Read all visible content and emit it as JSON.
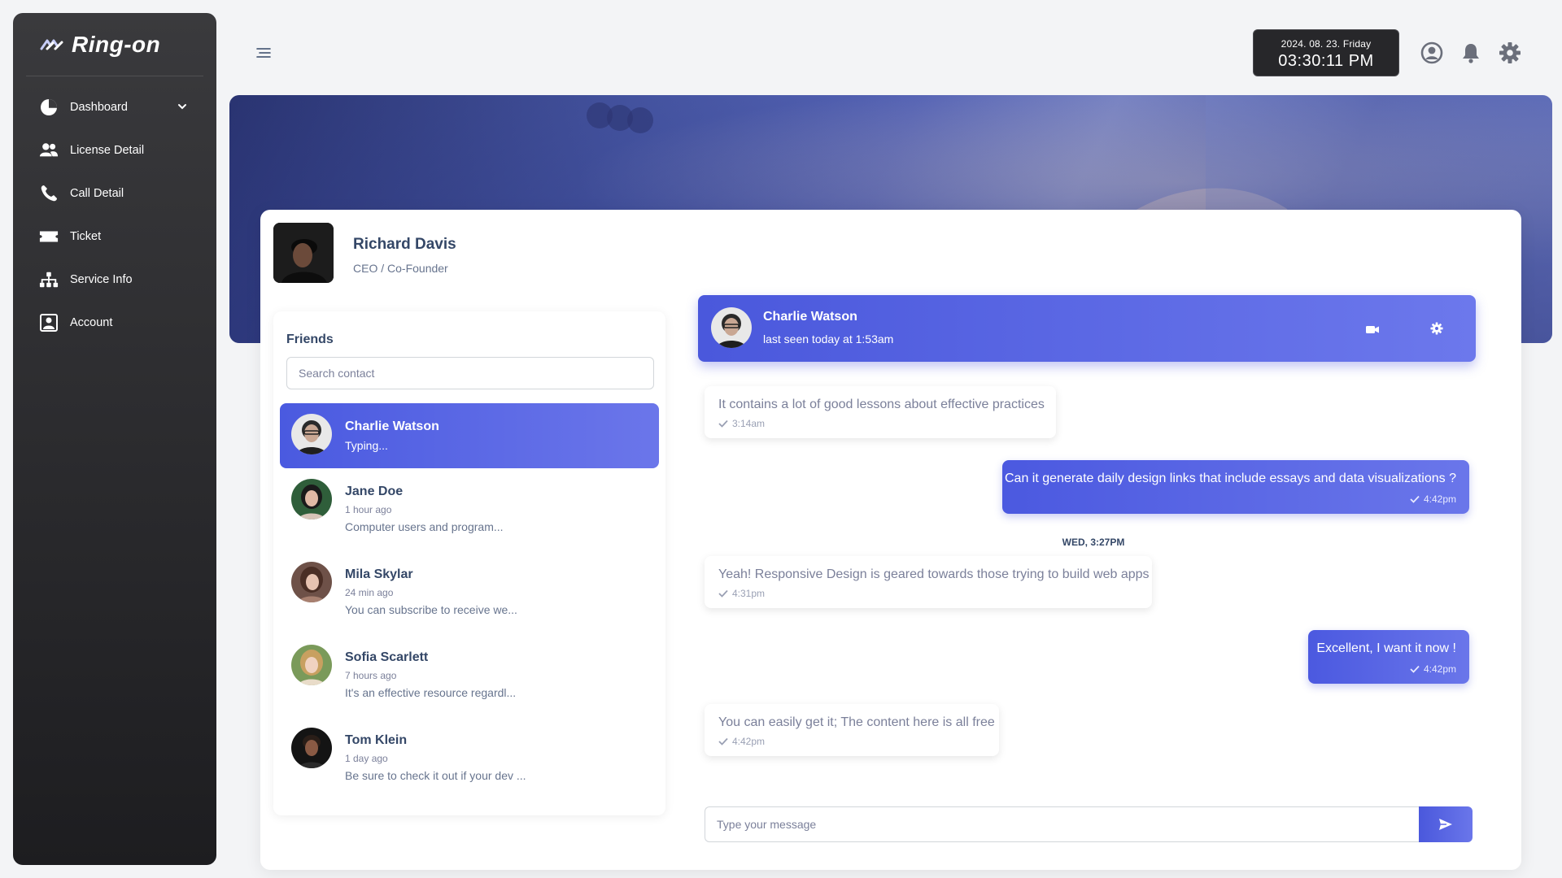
{
  "brand": {
    "name": "Ring-on"
  },
  "sidebar": {
    "items": [
      {
        "label": "Dashboard",
        "icon": "pie-chart-icon",
        "expandable": true
      },
      {
        "label": "License Detail",
        "icon": "users-icon"
      },
      {
        "label": "Call Detail",
        "icon": "phone-icon"
      },
      {
        "label": "Ticket",
        "icon": "ticket-icon"
      },
      {
        "label": "Service Info",
        "icon": "sitemap-icon"
      },
      {
        "label": "Account",
        "icon": "account-box-icon"
      }
    ]
  },
  "topbar": {
    "date": "2024. 08. 23. Friday",
    "time": "03:30:11 PM"
  },
  "profile": {
    "name": "Richard Davis",
    "role": "CEO / Co-Founder"
  },
  "friends": {
    "title": "Friends",
    "search_placeholder": "Search contact",
    "contacts": [
      {
        "name": "Charlie Watson",
        "status": "Typing...",
        "active": true
      },
      {
        "name": "Jane Doe",
        "time": "1 hour ago",
        "preview": "Computer users and program..."
      },
      {
        "name": "Mila Skylar",
        "time": "24 min ago",
        "preview": "You can subscribe to receive we..."
      },
      {
        "name": "Sofia Scarlett",
        "time": "7 hours ago",
        "preview": "It's an effective resource regardl..."
      },
      {
        "name": "Tom Klein",
        "time": "1 day ago",
        "preview": "Be sure to check it out if your dev ..."
      }
    ]
  },
  "chat": {
    "header": {
      "name": "Charlie Watson",
      "last_seen": "last seen today at 1:53am"
    },
    "messages": [
      {
        "dir": "in",
        "text": "It contains a lot of good lessons about effective practices",
        "time": "3:14am"
      },
      {
        "dir": "out",
        "text": "Can it generate daily design links that include essays and data visualizations ?",
        "time": "4:42pm"
      },
      {
        "dir": "in",
        "text": "Yeah! Responsive Design is geared towards those trying to build web apps",
        "time": "4:31pm"
      },
      {
        "dir": "out",
        "text": "Excellent, I want it now !",
        "time": "4:42pm"
      },
      {
        "dir": "in",
        "text": "You can easily get it; The content here is all free",
        "time": "4:42pm"
      }
    ],
    "day_separator": "WED, 3:27PM",
    "input_placeholder": "Type your message"
  },
  "colors": {
    "accent": "#4a58dc",
    "accent_light": "#6c78ec",
    "sidebar_top": "#3a3a3d",
    "sidebar_bottom": "#1d1d20",
    "text_primary": "#344767",
    "text_muted": "#7b809a"
  }
}
